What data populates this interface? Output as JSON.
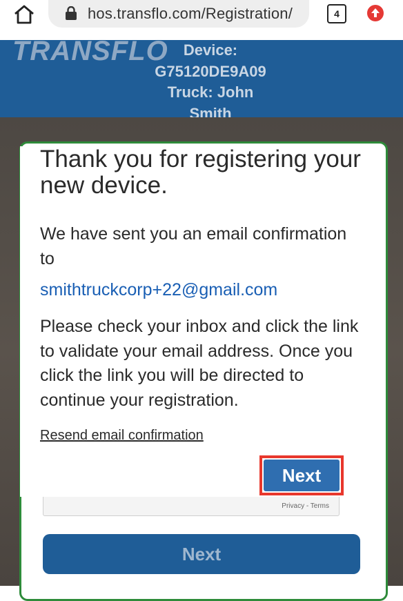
{
  "browser": {
    "url": "hos.transflo.com/Registration/",
    "tab_count": "4"
  },
  "header": {
    "logo": "TRANSFLO",
    "device_label": "Device:",
    "device_id": "G75120DE9A09",
    "truck_label": "Truck: John",
    "truck_name": "Smith"
  },
  "background": {
    "captcha_links": "Privacy - Terms",
    "next_label": "Next"
  },
  "modal": {
    "title": "Thank you for registering your new device.",
    "sent_text": "We have sent you an email confirmation to",
    "email": "smithtruckcorp+22@gmail.com",
    "instructions": "Please check your inbox and click the link to validate your email address. Once you click the link you will be directed to continue your registration.",
    "resend_label": "Resend email confirmation",
    "next_label": "Next"
  },
  "colors": {
    "header_bg": "#1f5d97",
    "link_blue": "#1a5fb4",
    "highlight_red": "#e8372c",
    "card_border_green": "#2e8b3a"
  },
  "icons": [
    "home-icon",
    "lock-icon",
    "tabs-icon",
    "upload-icon"
  ]
}
